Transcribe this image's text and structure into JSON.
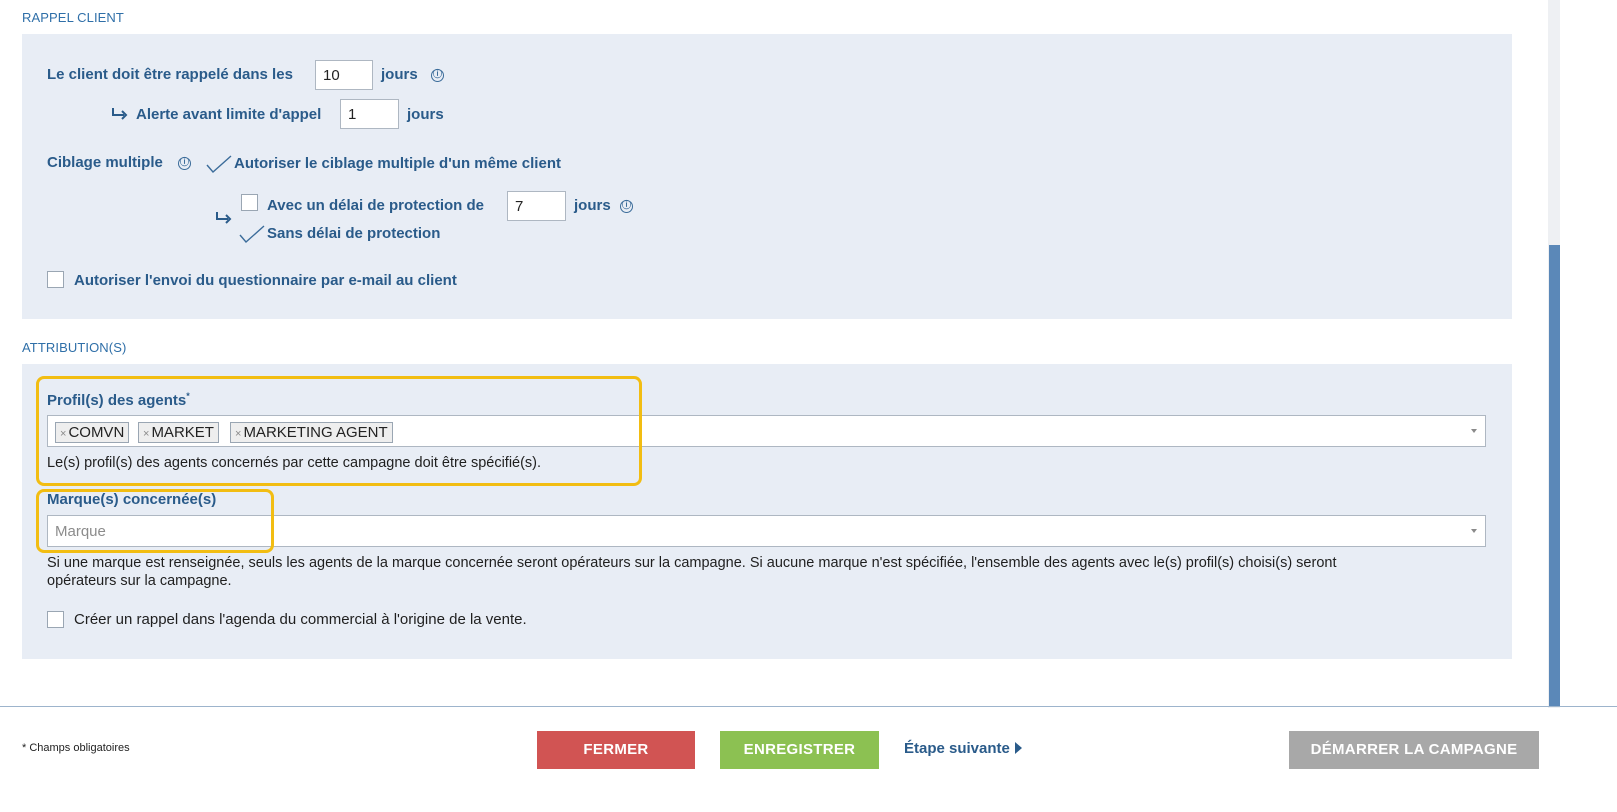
{
  "sections": {
    "rappel": "RAPPEL CLIENT",
    "attribution": "ATTRIBUTION(S)"
  },
  "rappel": {
    "call_label": "Le client doit être rappelé dans les",
    "call_days": "10",
    "days_unit": "jours",
    "alert_label": "Alerte avant limite d'appel",
    "alert_days": "1",
    "multi_label": "Ciblage multiple",
    "multi_option": "Autoriser le ciblage multiple d'un même client",
    "protection_label": "Avec un délai de protection de",
    "protection_days": "7",
    "no_protection_label": "Sans délai de protection",
    "email_label": "Autoriser l'envoi du questionnaire par e-mail au client"
  },
  "attribution": {
    "profiles_label": "Profil(s) des agents",
    "required_mark": "*",
    "profiles": [
      {
        "remove": "×",
        "label": "COMVN"
      },
      {
        "remove": "×",
        "label": "MARKET"
      },
      {
        "remove": "×",
        "label": "MARKETING AGENT"
      }
    ],
    "profiles_help": "Le(s) profil(s) des agents concernés par cette campagne doit être spécifié(s).",
    "brand_label": "Marque(s) concernée(s)",
    "brand_placeholder": "Marque",
    "brand_help_line1": "Si une marque est renseignée, seuls les agents de la marque concernée seront opérateurs sur la campagne. Si aucune marque n'est spécifiée, l'ensemble des agents avec le(s) profil(s) choisi(s) seront",
    "brand_help_line2": "opérateurs sur la campagne.",
    "reminder_label": "Créer un rappel dans l'agenda du commercial à l'origine de la vente."
  },
  "footer": {
    "required_note": "* Champs obligatoires",
    "close": "FERMER",
    "save": "ENREGISTRER",
    "next_step": "Étape suivante",
    "start": "DÉMARRER LA CAMPAGNE"
  },
  "colors": {
    "close": "#d15453",
    "save": "#8cc152",
    "start": "#a8a8a8",
    "highlight": "#f2bd12",
    "panel": "#e8edf5",
    "label": "#2a5b8a"
  },
  "icons": {
    "info": "ⓘ"
  }
}
